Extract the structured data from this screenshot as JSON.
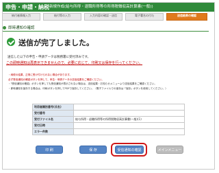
{
  "header": {
    "title": "申告・申請・納税",
    "subtitle": "新規作成(給与所得・退職所得等の所得税徴収高計算書(一般))"
  },
  "steps": [
    {
      "label": "納付者情報入力"
    },
    {
      "label": "給付等の入力"
    },
    {
      "label": "入力内容の確認・送信"
    },
    {
      "label": "電子署名の付与"
    },
    {
      "label": "送信結果の確認"
    }
  ],
  "section": {
    "title": "即時通知の確認"
  },
  "result": {
    "title": "送信が完了しました。",
    "message": "送信した以下の申告・申請データは税務署に受付済みです。",
    "warning": "この即時通知は再表示できませんので、必要に応じて、印刷又は保存を行ってください。"
  },
  "notes": [
    {
      "text": "・納税の結果、正常に受け付けられない場合があります。",
      "style": "red"
    },
    {
      "text": "  必ず受信通知の確認ボタンを押して、申告・申請データの送信結果をご確認ください。",
      "style": "red"
    },
    {
      "text": "・「受信通知の確認」ボタンを押しても受信通知が表示されない場合は、送信結果・お知らせメニューより送信結果をご確認ください。",
      "style": "normal"
    },
    {
      "text": "・即時通知を保存する場合は、印刷ボタンを押してPDFで保存してください。（電子ファイルでの保存は「保存」ボタンを使用してください。）",
      "style": "normal"
    }
  ],
  "details": [
    {
      "label": "利用者識別番号(氏名)",
      "value": ""
    },
    {
      "label": "受付番号",
      "value": ""
    },
    {
      "label": "受付ファイル名",
      "value": "給与所得・退職所得等の所得税徴収高計算書(一般)(1)"
    },
    {
      "label": "受付日時",
      "value": ""
    },
    {
      "label": "エラー件数",
      "value": ""
    }
  ],
  "buttons": {
    "print": "印 刷",
    "save": "保 存",
    "confirm": "受信通知の確認",
    "menu": "メインメニュー"
  },
  "colors": {
    "header_bg": "#2f8a3a",
    "active_step": "#e07a1c",
    "button_blue": "#5585c6",
    "warning_red": "#c00000",
    "highlight": "#d01818"
  }
}
